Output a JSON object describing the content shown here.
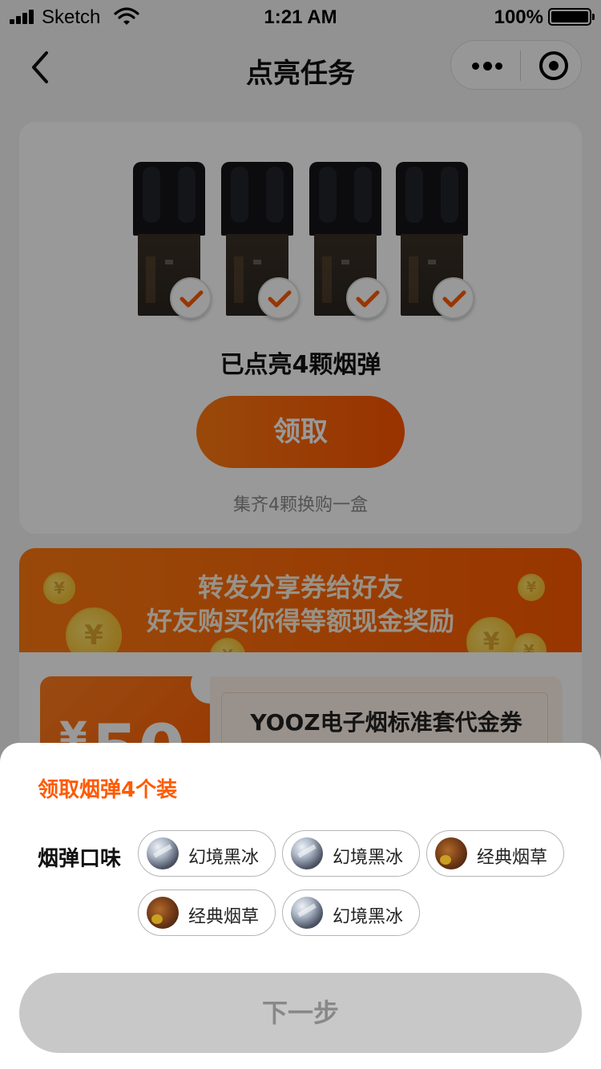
{
  "status_bar": {
    "carrier": "Sketch",
    "time": "1:21 AM",
    "battery": "100%"
  },
  "nav": {
    "title": "点亮任务",
    "back_icon": "chevron-left-icon",
    "more_icon": "more-dots-icon",
    "target_icon": "target-icon"
  },
  "task": {
    "pods": [
      {
        "lit": true
      },
      {
        "lit": true
      },
      {
        "lit": true
      },
      {
        "lit": true
      }
    ],
    "lit_text": "已点亮4颗烟弹",
    "claim_label": "领取",
    "hint": "集齐4颗换购一盒"
  },
  "share": {
    "line1": "转发分享券给好友",
    "line2": "好友购买你得等额现金奖励",
    "coin_symbol": "¥"
  },
  "coupon": {
    "currency": "¥",
    "amount": "50",
    "title": "YOOZ电子烟标准套代金券"
  },
  "sheet": {
    "title": "领取烟弹4个装",
    "flavor_label": "烟弹口味",
    "flavors": [
      {
        "label": "幻境黑冰",
        "kind": "ice"
      },
      {
        "label": "幻境黑冰",
        "kind": "ice"
      },
      {
        "label": "经典烟草",
        "kind": "tobacco"
      },
      {
        "label": "经典烟草",
        "kind": "tobacco"
      },
      {
        "label": "幻境黑冰",
        "kind": "ice"
      }
    ],
    "next_label": "下一步"
  },
  "colors": {
    "accent": "#ff5a00",
    "disabled_button": "#c8c8c8",
    "overlay": "rgba(0,0,0,0.40)"
  }
}
